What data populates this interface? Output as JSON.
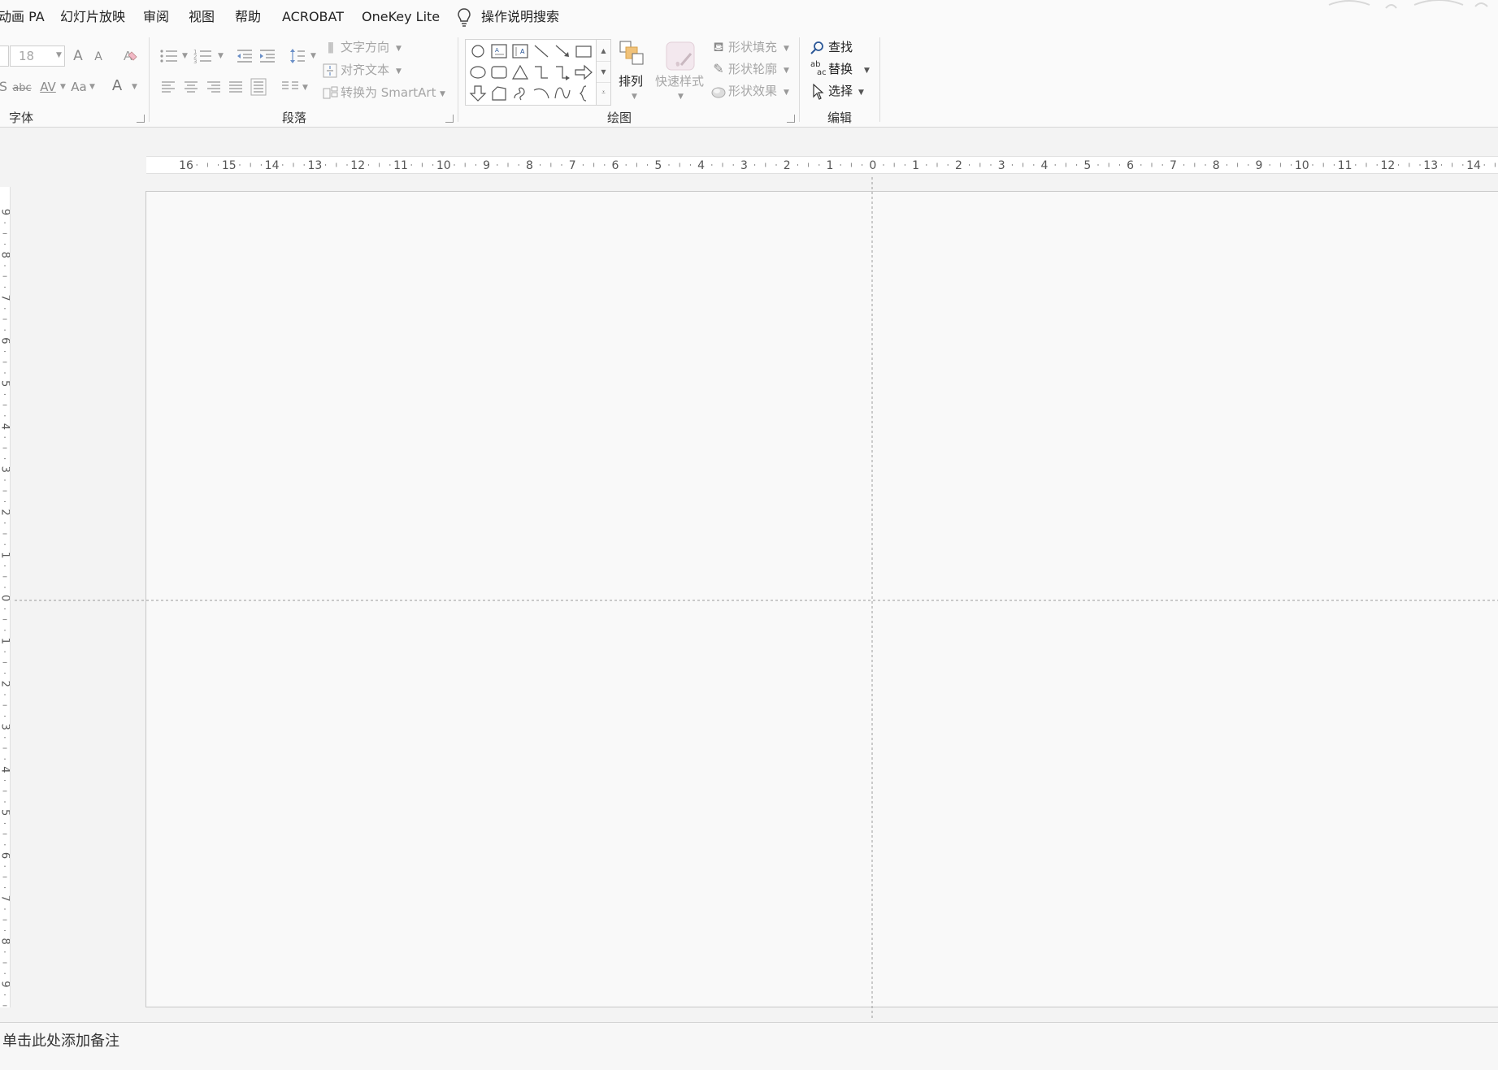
{
  "menu": {
    "tabs": [
      "动画 PA",
      "幻灯片放映",
      "审阅",
      "视图",
      "帮助",
      "ACROBAT",
      "OneKey Lite"
    ],
    "search_label": "操作说明搜索"
  },
  "font_group": {
    "label": "字体",
    "font_size_value": "18",
    "increase_icon": "A",
    "decrease_icon": "A",
    "strike_text": "abc",
    "spacing_text": "AV",
    "case_text": "Aa",
    "color_text": "A"
  },
  "paragraph_group": {
    "label": "段落",
    "text_direction": "文字方向",
    "align_text": "对齐文本",
    "smartart": "转换为 SmartArt"
  },
  "drawing_group": {
    "label": "绘图",
    "arrange": "排列",
    "quick_styles": "快速样式",
    "shape_fill": "形状填充",
    "shape_outline": "形状轮廓",
    "shape_effects": "形状效果"
  },
  "editing_group": {
    "label": "编辑",
    "find": "查找",
    "replace": "替换",
    "select": "选择",
    "replace_icon_top": "ab",
    "replace_icon_bottom": "ac"
  },
  "rulers": {
    "horizontal": [
      "16",
      "15",
      "14",
      "13",
      "12",
      "11",
      "10",
      "9",
      "8",
      "7",
      "6",
      "5",
      "4",
      "3",
      "2",
      "1",
      "0",
      "1",
      "2",
      "3",
      "4",
      "5",
      "6",
      "7",
      "8",
      "9",
      "10",
      "11",
      "12",
      "13",
      "14"
    ],
    "vertical": [
      "9",
      "8",
      "7",
      "6",
      "5",
      "4",
      "3",
      "2",
      "1",
      "0",
      "1",
      "2",
      "3",
      "4",
      "5",
      "6",
      "7",
      "8",
      "9"
    ]
  },
  "notes": {
    "placeholder": "单击此处添加备注"
  },
  "colors": {
    "arrange_accent": "#f0c27a",
    "find_icon": "#2b5797",
    "guide": "#9a9a9a"
  }
}
